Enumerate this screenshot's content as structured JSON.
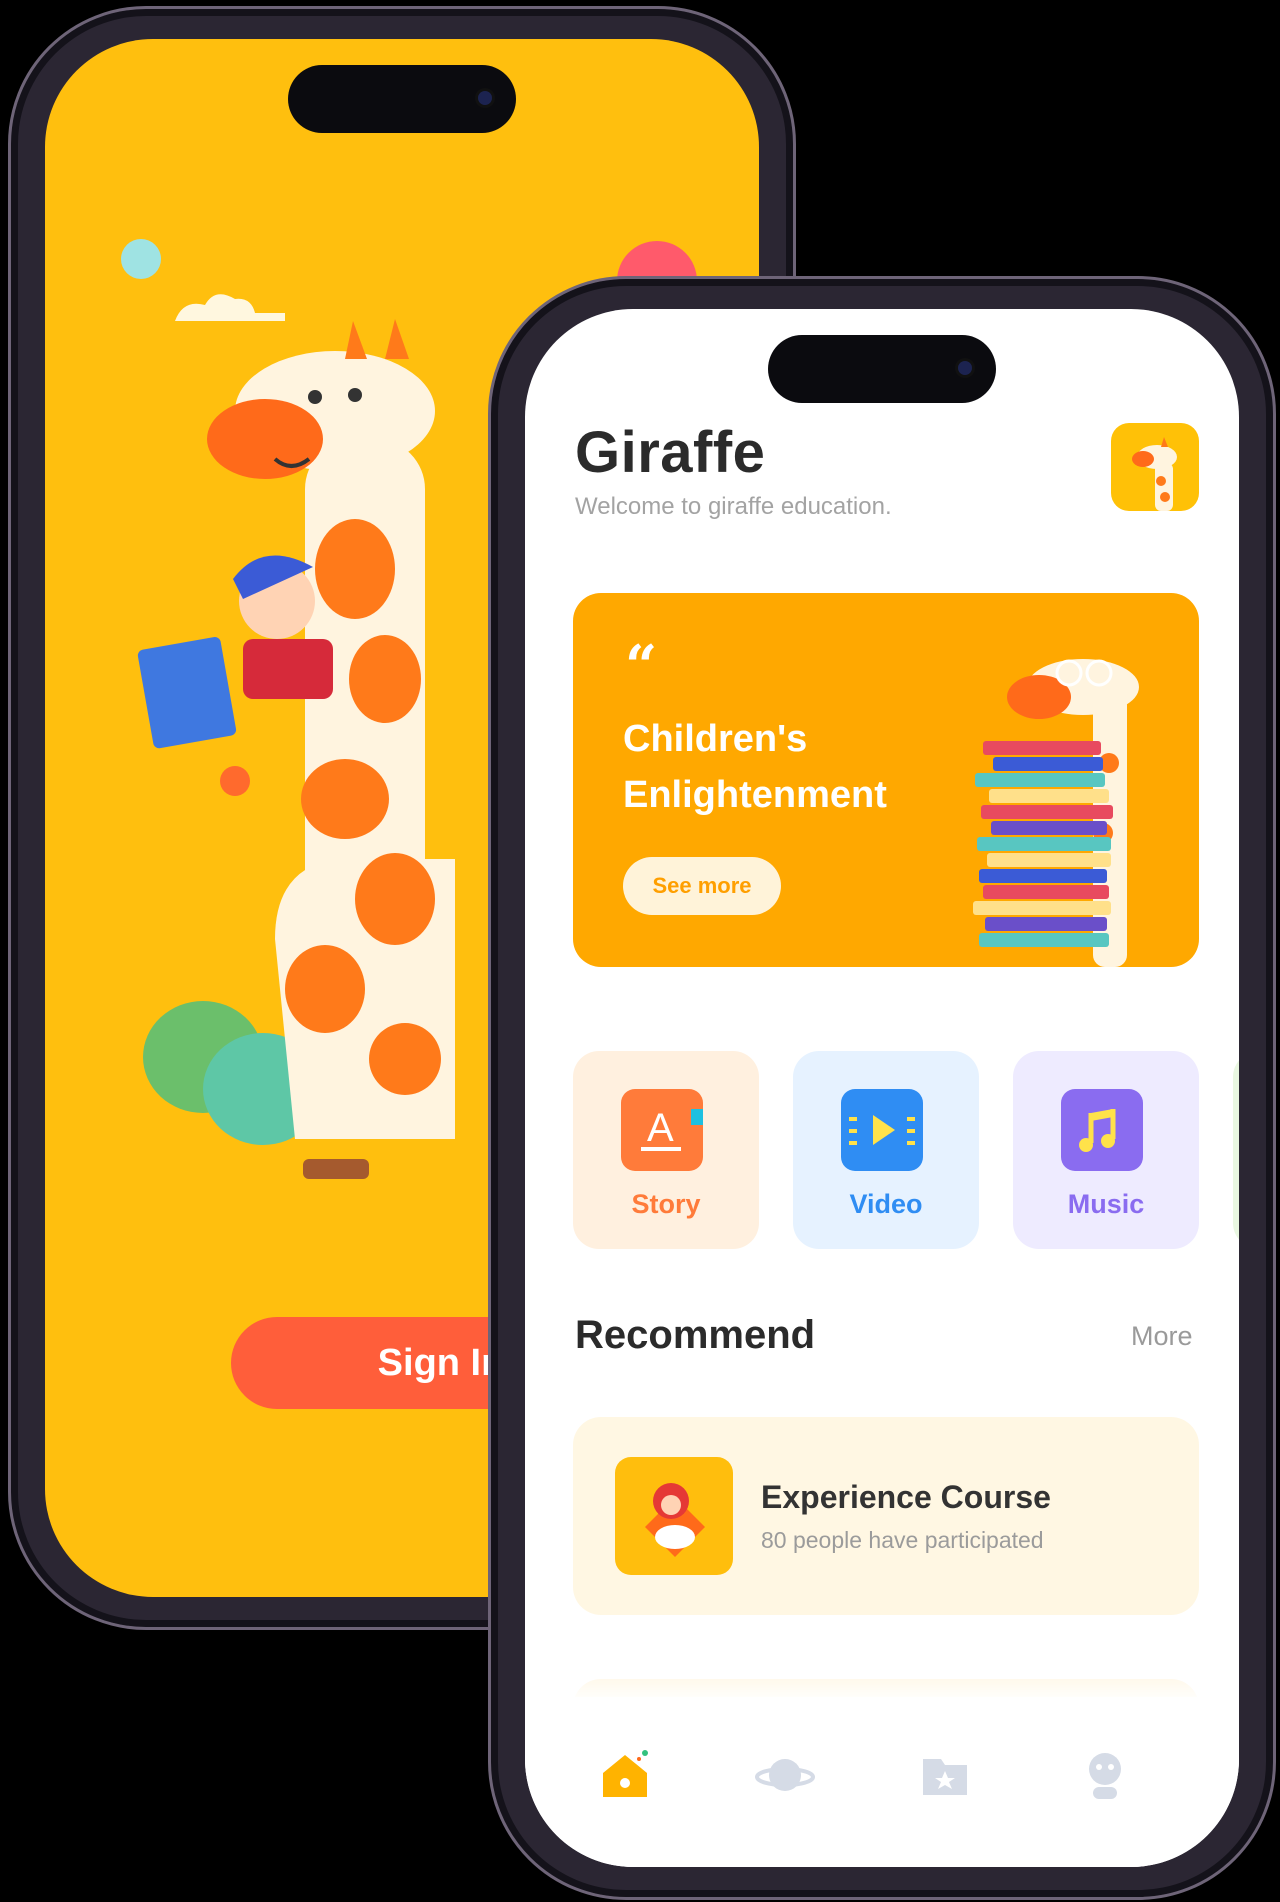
{
  "signin_screen": {
    "signin_label": "Sign In"
  },
  "home": {
    "app_title": "Giraffe",
    "subtitle": "Welcome to giraffe education.",
    "banner": {
      "quote_mark": "“",
      "title": "Children's Enlightenment",
      "button_label": "See more"
    },
    "categories": [
      {
        "label": "Story",
        "color": "#ff7b3a",
        "icon": "story-book-icon"
      },
      {
        "label": "Video",
        "color": "#2f8df3",
        "icon": "video-play-icon"
      },
      {
        "label": "Music",
        "color": "#8a6cf0",
        "icon": "music-note-icon"
      }
    ],
    "recommend": {
      "title": "Recommend",
      "more_label": "More",
      "courses": [
        {
          "title": "Experience Course",
          "subtitle": "80 people have participated"
        }
      ]
    },
    "tabbar": [
      "home-icon",
      "planet-icon",
      "folder-star-icon",
      "profile-icon"
    ]
  },
  "colors": {
    "brand_yellow": "#ffbf0e",
    "banner_orange": "#ffa800",
    "signin_red": "#ff5e3a"
  }
}
